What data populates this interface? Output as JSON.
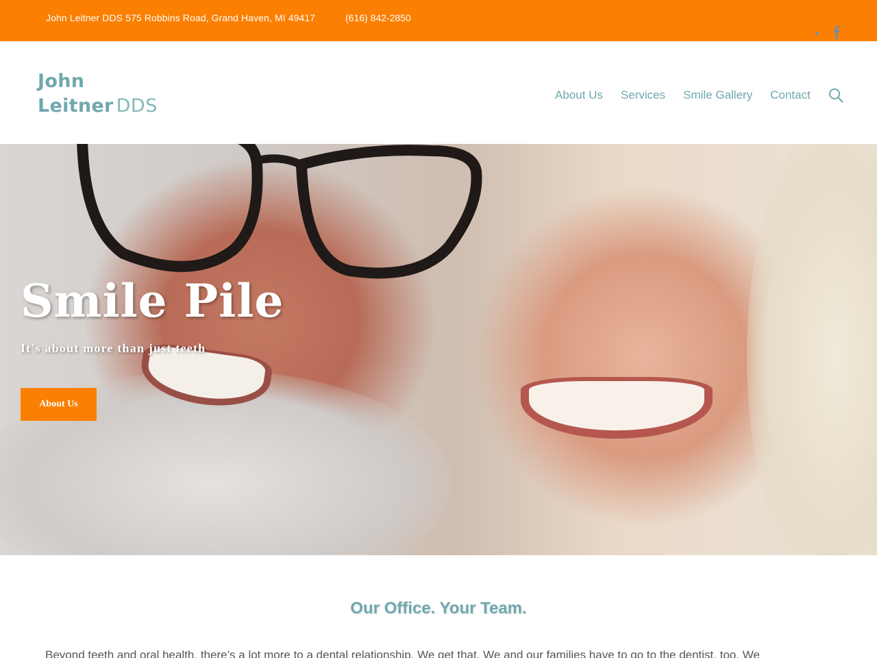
{
  "topbar": {
    "address": "John Leitner DDS 575 Robbins Road, Grand Haven, MI 49417",
    "phone": "(616) 842-2850",
    "social_icons": [
      "dot-icon",
      "facebook-icon"
    ]
  },
  "header": {
    "logo": {
      "line1": "John",
      "line2": "Leitner",
      "line3": "DDS"
    },
    "nav": [
      {
        "label": "About Us"
      },
      {
        "label": "Services"
      },
      {
        "label": "Smile Gallery"
      },
      {
        "label": "Contact"
      }
    ],
    "search_icon": "search-icon"
  },
  "hero": {
    "title": "Smile Pile",
    "subtitle": "It's about more than just teeth",
    "button_label": "About Us"
  },
  "content": {
    "section_title": "Our Office. Your Team.",
    "intro": "Beyond teeth and oral health, there’s a lot more to a dental relationship. We get that. We and our families have to go to the dentist, too. We"
  },
  "colors": {
    "accent": "#fb7f00",
    "brand_teal": "#6fa8ad"
  }
}
